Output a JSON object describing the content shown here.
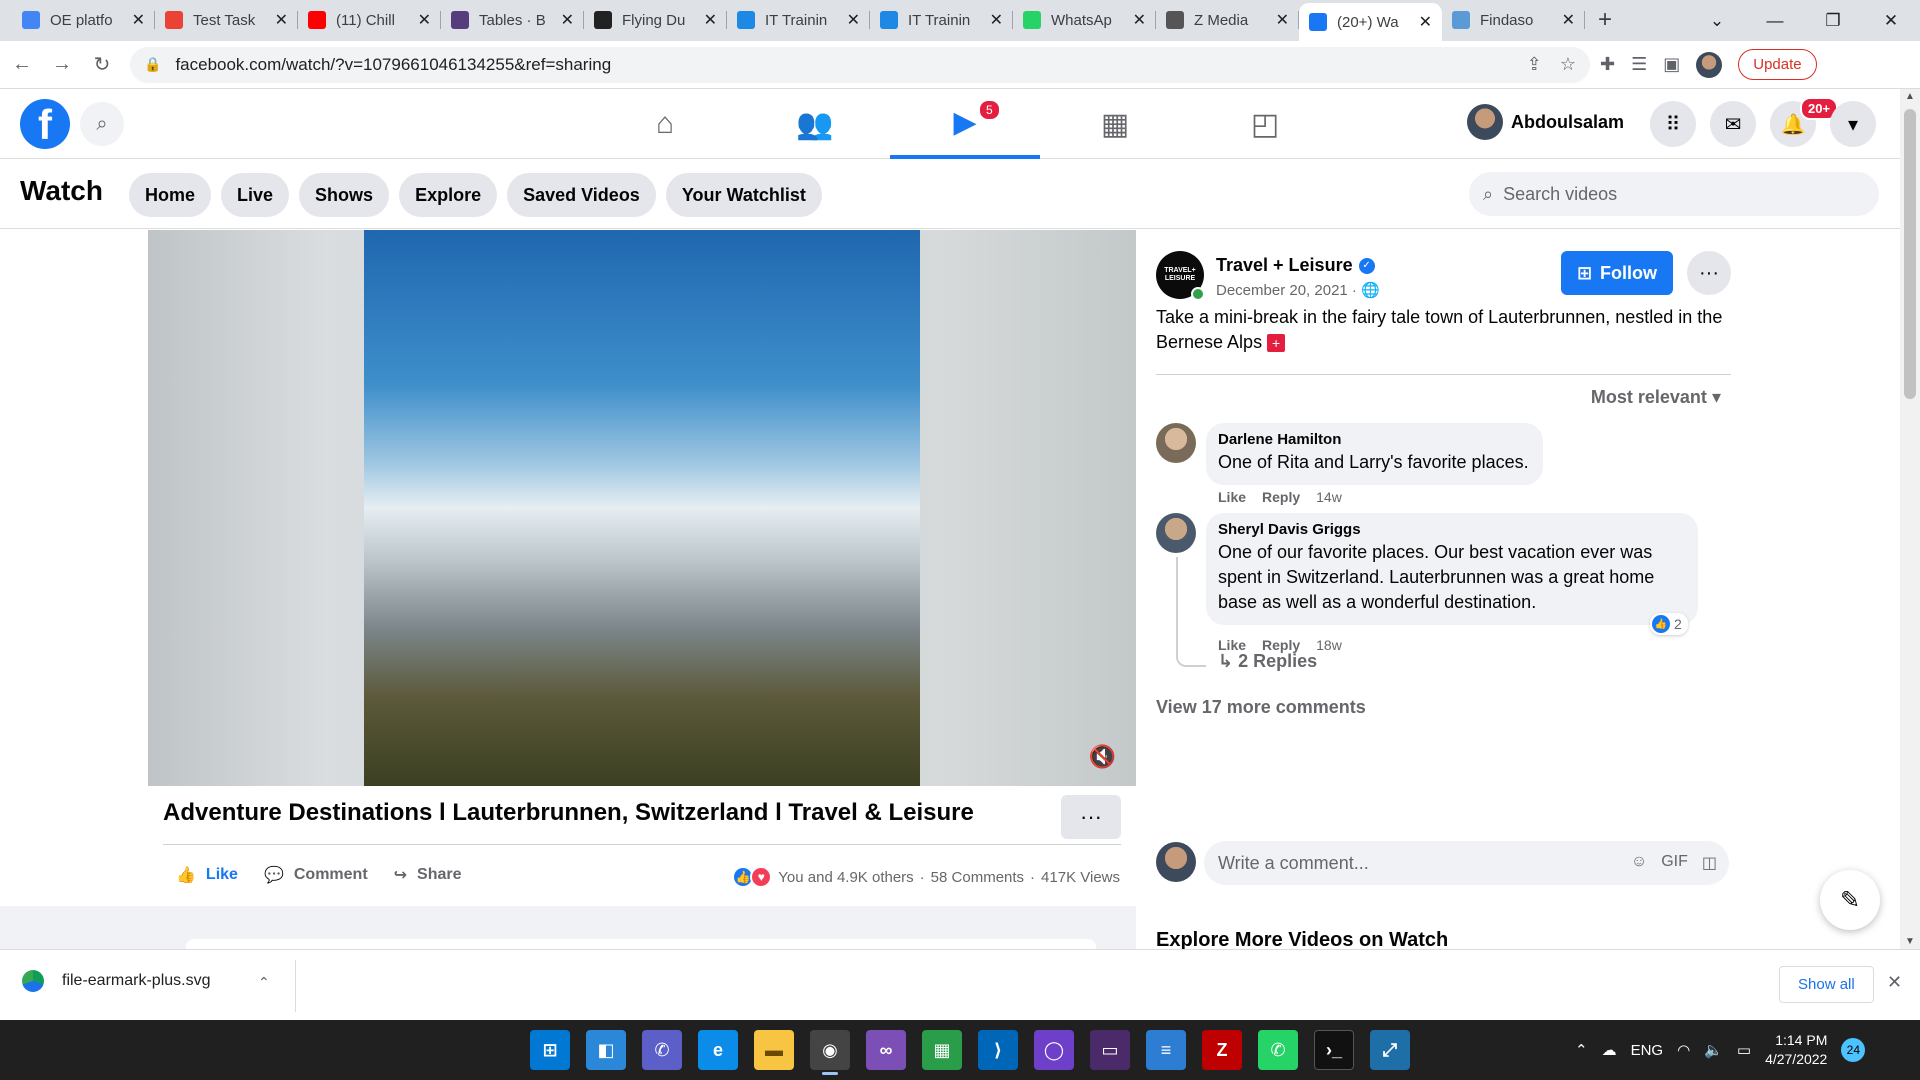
{
  "browser": {
    "tabs": [
      {
        "title": "OE platfo",
        "icon": "docs-icon",
        "color": "#4285f4"
      },
      {
        "title": "Test Task",
        "icon": "gmail-icon",
        "color": "#ea4335"
      },
      {
        "title": "(11) Chill",
        "icon": "youtube-icon",
        "color": "#ff0000"
      },
      {
        "title": "Tables · B",
        "icon": "bootstrap-icon",
        "color": "#563d7c"
      },
      {
        "title": "Flying Du",
        "icon": "angular-icon",
        "color": "#222222"
      },
      {
        "title": "IT Trainin",
        "icon": "c-logo-icon",
        "color": "#1e88e5"
      },
      {
        "title": "IT Trainin",
        "icon": "c-logo-icon",
        "color": "#1e88e5"
      },
      {
        "title": "WhatsAp",
        "icon": "whatsapp-icon",
        "color": "#25d366"
      },
      {
        "title": "Z Media",
        "icon": "zmedia-icon",
        "color": "#555555"
      },
      {
        "title": "(20+) Wa",
        "icon": "facebook-icon",
        "color": "#1877f2"
      },
      {
        "title": "Findaso",
        "icon": "findaso-icon",
        "color": "#5b9bd5"
      }
    ],
    "url": "facebook.com/watch/?v=1079661046134255&ref=sharing",
    "update_label": "Update"
  },
  "fb": {
    "watch_badge": "5",
    "user_name": "Abdoulsalam",
    "notif_badge": "20+",
    "brand_color": "#1877f2"
  },
  "watch": {
    "title": "Watch",
    "pills": [
      "Home",
      "Live",
      "Shows",
      "Explore",
      "Saved Videos",
      "Your Watchlist"
    ],
    "search_placeholder": "Search videos"
  },
  "video": {
    "title": "Adventure Destinations l Lauterbrunnen, Switzerland l Travel & Leisure",
    "like_label": "Like",
    "comment_label": "Comment",
    "share_label": "Share",
    "reactions_text": "You and 4.9K others",
    "comments_count": "58 Comments",
    "views": "417K Views"
  },
  "post": {
    "page_name": "Travel + Leisure",
    "avatar_text": "TRAVEL+ LEISURE",
    "date": "December 20, 2021 ·",
    "follow_label": "Follow",
    "caption": "Take a mini-break in the fairy tale town of Lauterbrunnen, nestled in the Bernese Alps",
    "sort_label": "Most relevant"
  },
  "comments": [
    {
      "name": "Darlene Hamilton",
      "text": "One of Rita and Larry's favorite places.",
      "like": "Like",
      "reply": "Reply",
      "time": "14w"
    },
    {
      "name": "Sheryl Davis Griggs",
      "text": "One of our favorite places. Our best vacation ever was spent in Switzerland. Lauterbrunnen was a great home base as well as a wonderful destination.",
      "like": "Like",
      "reply": "Reply",
      "time": "18w",
      "reactions": "2"
    }
  ],
  "replies_label": "2 Replies",
  "view_more": "View 17 more comments",
  "write_placeholder": "Write a comment...",
  "explore_heading": "Explore More Videos on Watch",
  "download": {
    "file": "file-earmark-plus.svg",
    "show_all": "Show all"
  },
  "taskbar": {
    "lang": "ENG",
    "time": "1:14 PM",
    "date": "4/27/2022",
    "notif_count": "24"
  }
}
